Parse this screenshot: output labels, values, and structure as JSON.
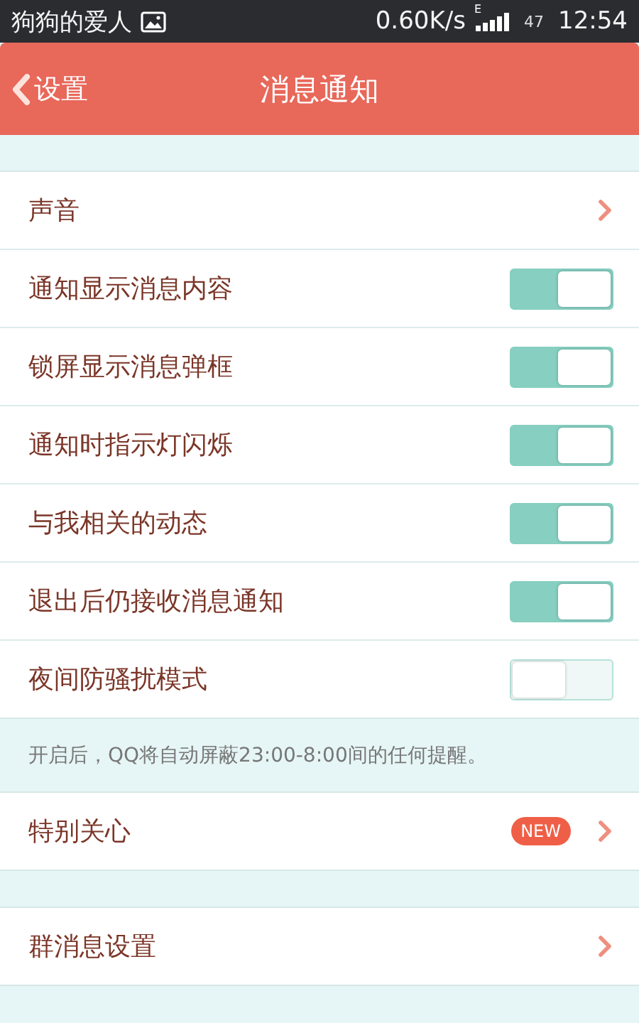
{
  "status_bar": {
    "notification": "狗狗的爱人",
    "speed": "0.60K/s",
    "network": "E",
    "battery": "47",
    "time": "12:54"
  },
  "header": {
    "back_label": "设置",
    "title": "消息通知"
  },
  "sections": [
    {
      "items": [
        {
          "kind": "link",
          "label": "声音"
        },
        {
          "kind": "toggle",
          "label": "通知显示消息内容",
          "on": true
        },
        {
          "kind": "toggle",
          "label": "锁屏显示消息弹框",
          "on": true
        },
        {
          "kind": "toggle",
          "label": "通知时指示灯闪烁",
          "on": true
        },
        {
          "kind": "toggle",
          "label": "与我相关的动态",
          "on": true
        },
        {
          "kind": "toggle",
          "label": "退出后仍接收消息通知",
          "on": true
        },
        {
          "kind": "toggle",
          "label": "夜间防骚扰模式",
          "on": false
        }
      ],
      "note": "开启后，QQ将自动屏蔽23:00-8:00间的任何提醒。"
    },
    {
      "items": [
        {
          "kind": "link",
          "label": "特别关心",
          "badge": "NEW"
        }
      ]
    },
    {
      "items": [
        {
          "kind": "link",
          "label": "群消息设置"
        }
      ]
    }
  ]
}
